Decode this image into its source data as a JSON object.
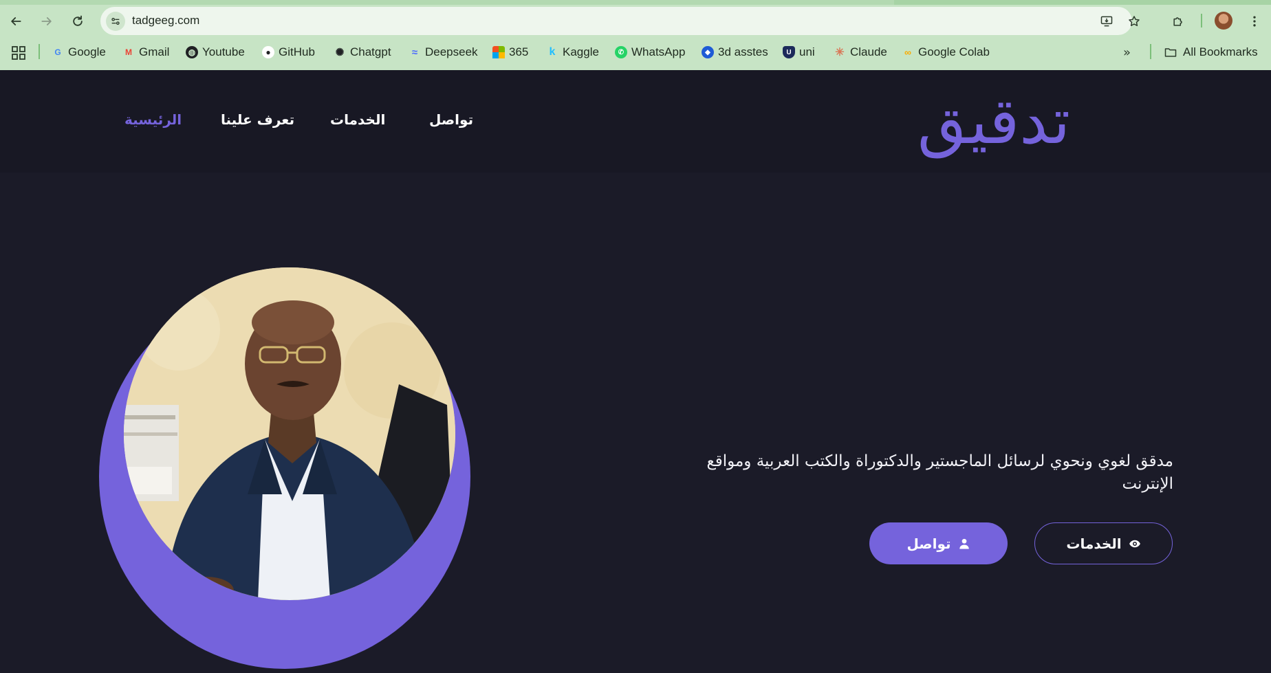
{
  "browser": {
    "url": "tadgeeg.com",
    "bookmarks": [
      {
        "label": "Google",
        "icon": "google-icon",
        "color": "#4285f4"
      },
      {
        "label": "Gmail",
        "icon": "gmail-icon",
        "color": "#ea4335"
      },
      {
        "label": "Youtube",
        "icon": "globe-icon",
        "color": "#202124"
      },
      {
        "label": "GitHub",
        "icon": "github-icon",
        "color": "#202124"
      },
      {
        "label": "Chatgpt",
        "icon": "chatgpt-icon",
        "color": "#202124"
      },
      {
        "label": "Deepseek",
        "icon": "deepseek-icon",
        "color": "#4d6bfe"
      },
      {
        "label": "365",
        "icon": "microsoft-icon",
        "color": "#f25022"
      },
      {
        "label": "Kaggle",
        "icon": "kaggle-icon",
        "color": "#20beff"
      },
      {
        "label": "WhatsApp",
        "icon": "whatsapp-icon",
        "color": "#25d366"
      },
      {
        "label": "3d asstes",
        "icon": "3d-assets-icon",
        "color": "#1e5bd6"
      },
      {
        "label": "uni",
        "icon": "uni-shield-icon",
        "color": "#1c2a5a"
      },
      {
        "label": "Claude",
        "icon": "claude-icon",
        "color": "#d97757"
      },
      {
        "label": "Google Colab",
        "icon": "colab-icon",
        "color": "#f9ab00"
      }
    ],
    "all_bookmarks_label": "All Bookmarks"
  },
  "site": {
    "logo": "تدقيق",
    "nav": [
      {
        "label": "الرئيسية",
        "active": true
      },
      {
        "label": "تعرف علينا",
        "active": false
      },
      {
        "label": "الخدمات",
        "active": false
      },
      {
        "label": "تواصل",
        "active": false
      }
    ],
    "hero": {
      "tagline": "مدقق لغوي ونحوي لرسائل الماجستير والدكتوراة والكتب العربية ومواقع الإنترنت",
      "services_button": "الخدمات",
      "contact_button": "تواصل"
    },
    "colors": {
      "accent": "#7563dc",
      "background": "#1b1b28",
      "header": "#181824",
      "chrome": "#c7e4c5"
    }
  }
}
